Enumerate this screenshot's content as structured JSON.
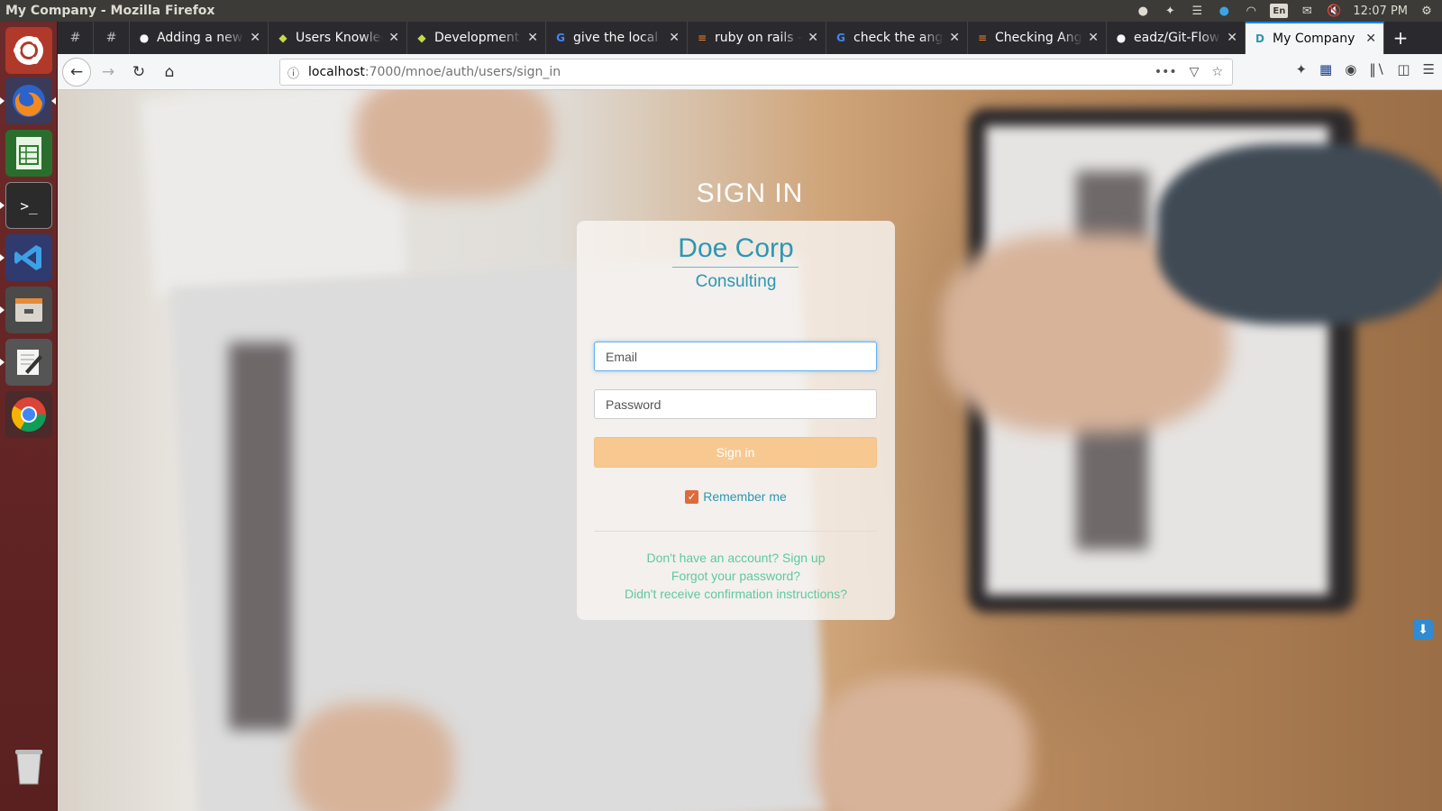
{
  "system_bar": {
    "window_title": "My Company - Mozilla Firefox",
    "keyboard_layout": "En",
    "clock": "12:07 PM"
  },
  "launcher": {
    "items": [
      "ubuntu-dash",
      "firefox",
      "libreoffice-calc",
      "terminal",
      "vscode",
      "file-manager",
      "text-editor",
      "chrome",
      "trash"
    ]
  },
  "tabs": [
    {
      "title": "#",
      "pinned": true,
      "icon": "hash-icon"
    },
    {
      "title": "#",
      "pinned": true,
      "icon": "hash-icon"
    },
    {
      "title": "Adding a new S",
      "icon": "github-icon"
    },
    {
      "title": "Users Knowled",
      "icon": "confluence-icon"
    },
    {
      "title": "Development S",
      "icon": "confluence-icon"
    },
    {
      "title": "give the local p",
      "icon": "google-icon"
    },
    {
      "title": "ruby on rails - H",
      "icon": "stackoverflow-icon"
    },
    {
      "title": "check the angu",
      "icon": "google-icon"
    },
    {
      "title": "Checking Angu",
      "icon": "stackoverflow-icon"
    },
    {
      "title": "eadz/Git-Flow-",
      "icon": "github-icon"
    },
    {
      "title": "My Company",
      "active": true,
      "icon": "page-d-icon"
    }
  ],
  "url": {
    "host": "localhost",
    "path": ":7000/mnoe/auth/users/sign_in"
  },
  "page": {
    "heading": "SIGN IN",
    "brand_name": "Doe Corp",
    "brand_sub": "Consulting",
    "email_placeholder": "Email",
    "password_placeholder": "Password",
    "signin_label": "Sign in",
    "remember_label": "Remember me",
    "remember_checked": true,
    "link_signup": "Don't have an account? Sign up",
    "link_forgot": "Forgot your password?",
    "link_confirm": "Didn't receive confirmation instructions?"
  },
  "colors": {
    "brand": "#2d97b2",
    "signin_button": "#f7c991",
    "links": "#5fc9a0",
    "checkbox": "#dd6b3c",
    "launcher": "#6d2a2a"
  }
}
